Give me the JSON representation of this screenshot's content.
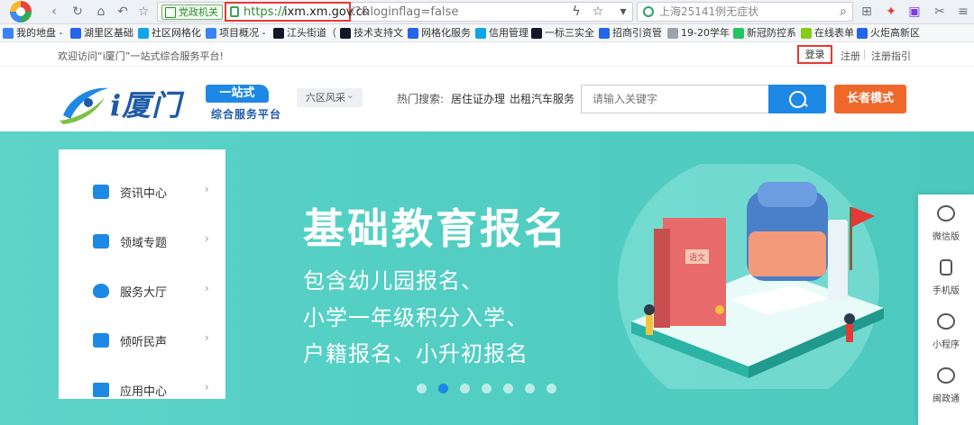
{
  "browser": {
    "gov_tag": "党政机关",
    "url_https": "https://",
    "url_domain": "ixm.xm.gov.cn",
    "url_rest": "/?&loginflag=false",
    "search_text": "上海25141例无症状"
  },
  "bookmarks": [
    {
      "label": "我的地盘 -",
      "color": "#3b82f6"
    },
    {
      "label": "湖里区基础",
      "color": "#2563eb"
    },
    {
      "label": "社区网格化",
      "color": "#0ea5e9"
    },
    {
      "label": "项目概况 -",
      "color": "#3b82f6"
    },
    {
      "label": "江头街道（",
      "color": "#111827"
    },
    {
      "label": "技术支持文",
      "color": "#111827"
    },
    {
      "label": "网格化服务",
      "color": "#2563eb"
    },
    {
      "label": "信用管理",
      "color": "#0ea5e9"
    },
    {
      "label": "一标三实全",
      "color": "#111827"
    },
    {
      "label": "招商引资管",
      "color": "#2563eb"
    },
    {
      "label": "19-20学年",
      "color": "#9ca3af"
    },
    {
      "label": "新冠防控系",
      "color": "#22c55e"
    },
    {
      "label": "在线表单",
      "color": "#84cc16"
    },
    {
      "label": "火炬高新区",
      "color": "#2563eb"
    }
  ],
  "sitebar": {
    "welcome": "欢迎访问“i厦门”一站式综合服务平台!",
    "login": "登录",
    "register": "注册",
    "guide": "注册指引"
  },
  "header": {
    "brand_name": "i厦门",
    "brand_badge": "一站式",
    "brand_sub": "综合服务平台",
    "region": "六区风采",
    "hot_label": "热门搜索:",
    "hot_items": [
      "居住证办理",
      "出租汽车服务"
    ],
    "search_placeholder": "请输入关键字",
    "elder_mode": "长者模式"
  },
  "menu": [
    {
      "label": "资讯中心"
    },
    {
      "label": "领域专题"
    },
    {
      "label": "服务大厅"
    },
    {
      "label": "倾听民声"
    },
    {
      "label": "应用中心"
    }
  ],
  "hero": {
    "title": "基础教育报名",
    "lines": [
      "包含幼儿园报名、",
      "小学一年级积分入学、",
      "户籍报名、小升初报名"
    ],
    "dot_count": 7,
    "active_dot": 2,
    "book_label": "语文"
  },
  "float_panel": [
    {
      "label": "微信版"
    },
    {
      "label": "手机版"
    },
    {
      "label": "小程序"
    },
    {
      "label": "闽政通"
    }
  ],
  "colors": {
    "hero_bg": "#53cfc4",
    "accent": "#1e88e5",
    "elder": "#f0672a",
    "highlight": "#e53935"
  }
}
